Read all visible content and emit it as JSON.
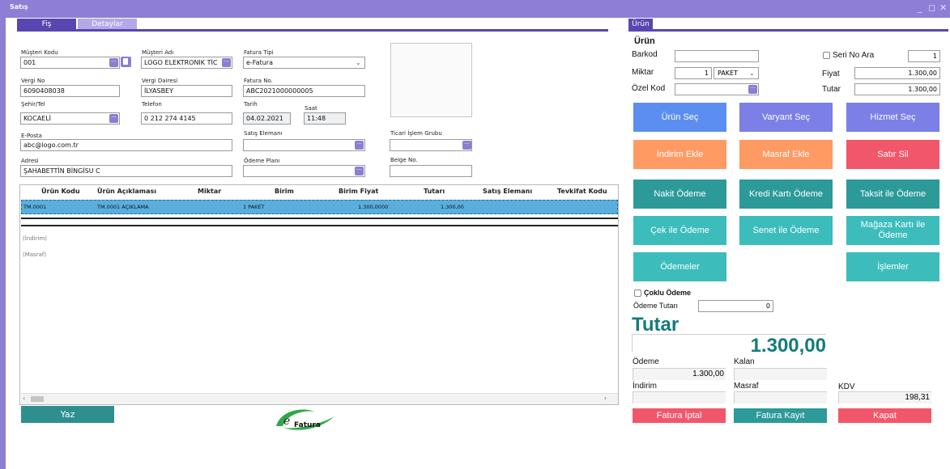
{
  "window": {
    "title": "Satış",
    "minimize": "_",
    "restore": "◻",
    "close": "✕"
  },
  "tabs": {
    "fis": "Fiş",
    "detaylar": "Detaylar",
    "urun": "Ürün"
  },
  "form": {
    "musteri_kodu": {
      "label": "Müşteri Kodu",
      "value": "001"
    },
    "musteri_adi": {
      "label": "Müşteri Adı",
      "value": "LOGO ELEKTRONIK TİC"
    },
    "fatura_tipi": {
      "label": "Fatura Tipi",
      "value": "e-Fatura"
    },
    "vergi_no": {
      "label": "Vergi No",
      "value": "6090408038"
    },
    "vergi_dairesi": {
      "label": "Vergi Dairesi",
      "value": "İLYASBEY"
    },
    "fatura_no": {
      "label": "Fatura No.",
      "value": "ABC2021000000005"
    },
    "sehir_tel": {
      "label": "Şehir/Tel",
      "value": "KOCAELİ"
    },
    "telefon": {
      "label": "Telefon",
      "value": "0 212 274 4145"
    },
    "tarih": {
      "label": "Tarih",
      "value": "04.02.2021"
    },
    "saat": {
      "label": "Saat",
      "value": "11:48"
    },
    "e_posta": {
      "label": "E-Posta",
      "value": "abc@logo.com.tr"
    },
    "satis_elemani": {
      "label": "Satış Elemanı",
      "value": ""
    },
    "ticari_islem_grubu": {
      "label": "Ticari İşlem Grubu",
      "value": ""
    },
    "adresi": {
      "label": "Adresi",
      "value": "ŞAHABETTİN BİNGİSU C"
    },
    "odeme_plani": {
      "label": "Ödeme Planı",
      "value": ""
    },
    "belge_no": {
      "label": "Belge No.",
      "value": ""
    }
  },
  "grid": {
    "headers": [
      "Ürün Kodu",
      "Ürün Açıklaması",
      "Miktar",
      "Birim",
      "Birim Fiyat",
      "Tutarı",
      "Satış Elemanı",
      "Tevkifat Kodu"
    ],
    "row": {
      "kod": "TM.0001",
      "aciklama": "TM.0001 AÇIKLAMA",
      "birim": "1 PAKET",
      "birim_fiyat": "1.300,0000",
      "tutar": "1.300,00"
    },
    "indirim_note": "(İndirim)",
    "masraf_note": "(Masraf)"
  },
  "buttons": {
    "yaz": "Yaz"
  },
  "logo": {
    "e": "e",
    "fatura": "Fatura"
  },
  "urun_panel": {
    "heading": "Ürün",
    "barkod": {
      "label": "Barkod",
      "value": ""
    },
    "seri_no_ara": {
      "label": "Seri No Ara",
      "value": "1"
    },
    "miktar": {
      "label": "Miktar",
      "value": "1",
      "unit": "PAKET"
    },
    "fiyat": {
      "label": "Fiyat",
      "value": "1.300,00"
    },
    "ozel_kod": {
      "label": "Özel Kod",
      "value": ""
    },
    "tutar": {
      "label": "Tutar",
      "value": "1.300,00"
    }
  },
  "tiles": {
    "urun_sec": "Ürün Seç",
    "varyant_sec": "Varyant Seç",
    "hizmet_sec": "Hizmet Seç",
    "indirim_ekle": "İndirim Ekle",
    "masraf_ekle": "Masraf Ekle",
    "satir_sil": "Satır Sil",
    "nakit_odeme": "Nakit Ödeme",
    "kredi_karti_odeme": "Kredi Kartı Ödeme",
    "taksit_ile_odeme": "Taksit ile Ödeme",
    "cek_ile_odeme": "Çek ile Ödeme",
    "senet_ile_odeme": "Senet ile Ödeme",
    "magaza_karti_ile_odeme": "Mağaza Kartı ile Ödeme",
    "odemeler": "Ödemeler",
    "islemler": "İşlemler"
  },
  "payment": {
    "coklu_odeme": "Çoklu Ödeme",
    "odeme_tutari_label": "Ödeme Tutarı",
    "odeme_tutari_value": "0",
    "tutar_label": "Tutar",
    "tutar_value": "1.300,00",
    "odeme_label": "Ödeme",
    "odeme_value": "1.300,00",
    "kalan_label": "Kalan",
    "kalan_value": "",
    "indirim_label": "İndirim",
    "indirim_value": "",
    "masraf_label": "Masraf",
    "masraf_value": "",
    "kdv_label": "KDV",
    "kdv_value": "198,31"
  },
  "bottom_buttons": {
    "fatura_iptal": "Fatura İptal",
    "fatura_kayit": "Fatura Kayıt",
    "kapat": "Kapat"
  },
  "colors": {
    "title_bar": "#8f7ed6",
    "tab_active": "#5a46b0",
    "accent_teal": "#157b7b",
    "row_highlight": "#5aaede"
  }
}
